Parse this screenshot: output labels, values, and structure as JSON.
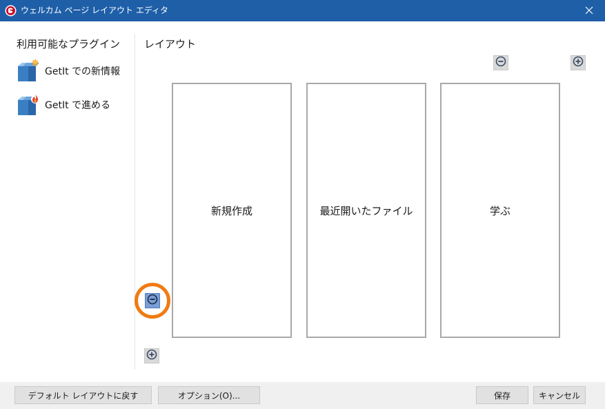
{
  "window": {
    "title": "ウェルカム ページ レイアウト エディタ",
    "app_icon": "delphi-helmet-icon",
    "close_glyph": "✕"
  },
  "plugins": {
    "heading": "利用可能なプラグイン",
    "items": [
      {
        "label": "GetIt での新情報",
        "icon": "package-star-icon"
      },
      {
        "label": "GetIt で進める",
        "icon": "package-flame-icon"
      }
    ]
  },
  "layout": {
    "heading": "レイアウト",
    "columns": [
      {
        "label": "新規作成"
      },
      {
        "label": "最近開いたファイル"
      },
      {
        "label": "学ぶ"
      }
    ],
    "controls": {
      "remove_column": "minus-circle-icon",
      "add_column": "plus-circle-icon",
      "remove_row": "minus-circle-icon",
      "add_row": "plus-circle-icon"
    },
    "highlight_color": "#f07b12"
  },
  "footer": {
    "reset_label": "デフォルト レイアウトに戻す",
    "options_label": "オプション(O)...",
    "save_label": "保存",
    "cancel_label": "キャンセル"
  },
  "colors": {
    "titlebar": "#1e5fa8",
    "panel_border": "#a8a8a8",
    "footer_bg": "#f0f0f0"
  }
}
